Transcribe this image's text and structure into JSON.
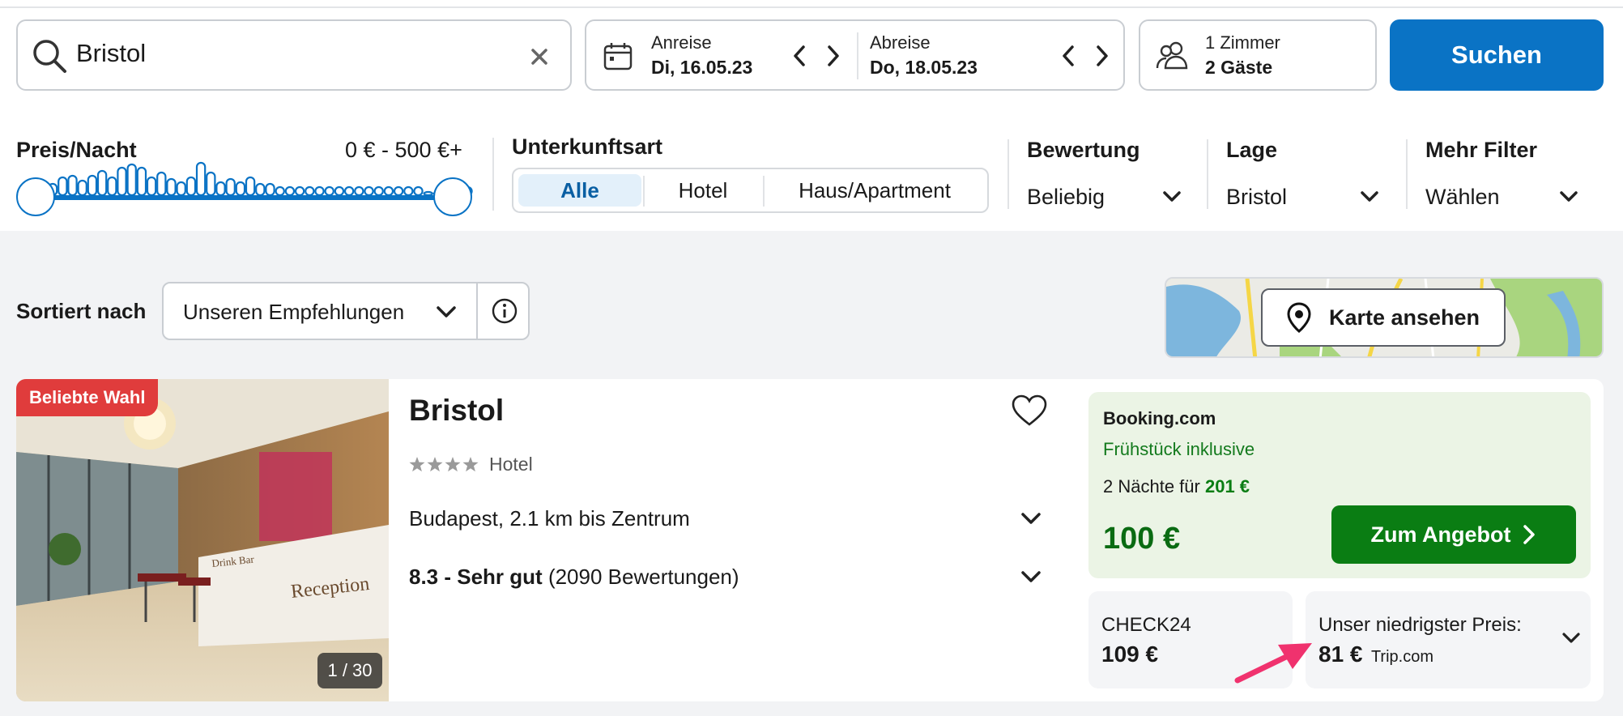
{
  "search": {
    "destination": "Bristol"
  },
  "dates": {
    "checkin_label": "Anreise",
    "checkin_value": "Di, 16.05.23",
    "checkout_label": "Abreise",
    "checkout_value": "Do, 18.05.23"
  },
  "guests": {
    "rooms": "1 Zimmer",
    "guests": "2 Gäste"
  },
  "search_button": "Suchen",
  "filters": {
    "price": {
      "label": "Preis/Nacht",
      "range": "0 € - 500 €+",
      "histogram": [
        0.35,
        0.55,
        0.6,
        0.45,
        0.6,
        0.75,
        0.55,
        0.85,
        0.95,
        0.85,
        0.55,
        0.7,
        0.5,
        0.4,
        0.55,
        1.0,
        0.7,
        0.4,
        0.5,
        0.4,
        0.55,
        0.35,
        0.35,
        0.25,
        0.25,
        0.25,
        0.25,
        0.25,
        0.25,
        0.25,
        0.25,
        0.25,
        0.25,
        0.25,
        0.25,
        0.25,
        0.25,
        0.25,
        0.1,
        0.1,
        0.25,
        0.25,
        0.25
      ]
    },
    "type": {
      "label": "Unterkunftsart",
      "options": [
        "Alle",
        "Hotel",
        "Haus/Apartment"
      ],
      "selected": "Alle"
    },
    "rating": {
      "label": "Bewertung",
      "value": "Beliebig"
    },
    "location": {
      "label": "Lage",
      "value": "Bristol"
    },
    "more": {
      "label": "Mehr Filter",
      "value": "Wählen"
    }
  },
  "sort": {
    "label": "Sortiert nach",
    "value": "Unseren Empfehlungen"
  },
  "map": {
    "button": "Karte ansehen"
  },
  "result": {
    "badge": "Beliebte Wahl",
    "photo_counter": "1 / 30",
    "photo_signs": {
      "bar": "Drink Bar",
      "reception": "Reception"
    },
    "name": "Bristol",
    "stars": 4,
    "type": "Hotel",
    "location": "Budapest, 2.1 km bis Zentrum",
    "rating_score": "8.3 - Sehr gut",
    "rating_count": "(2090 Bewertungen)",
    "offer": {
      "provider": "Booking.com",
      "extra": "Frühstück inklusive",
      "nights_prefix": "2 Nächte für",
      "nights_total": "201 €",
      "price": "100 €",
      "button": "Zum Angebot"
    },
    "alt_offer": {
      "provider": "CHECK24",
      "price": "109 €"
    },
    "lowest": {
      "label": "Unser niedrigster Preis:",
      "price": "81 €",
      "provider": "Trip.com"
    }
  },
  "colors": {
    "accent": "#0a73c5",
    "deal_green": "#0a7d13",
    "badge_red": "#e03c3c",
    "annotation_arrow": "#f0326e"
  }
}
